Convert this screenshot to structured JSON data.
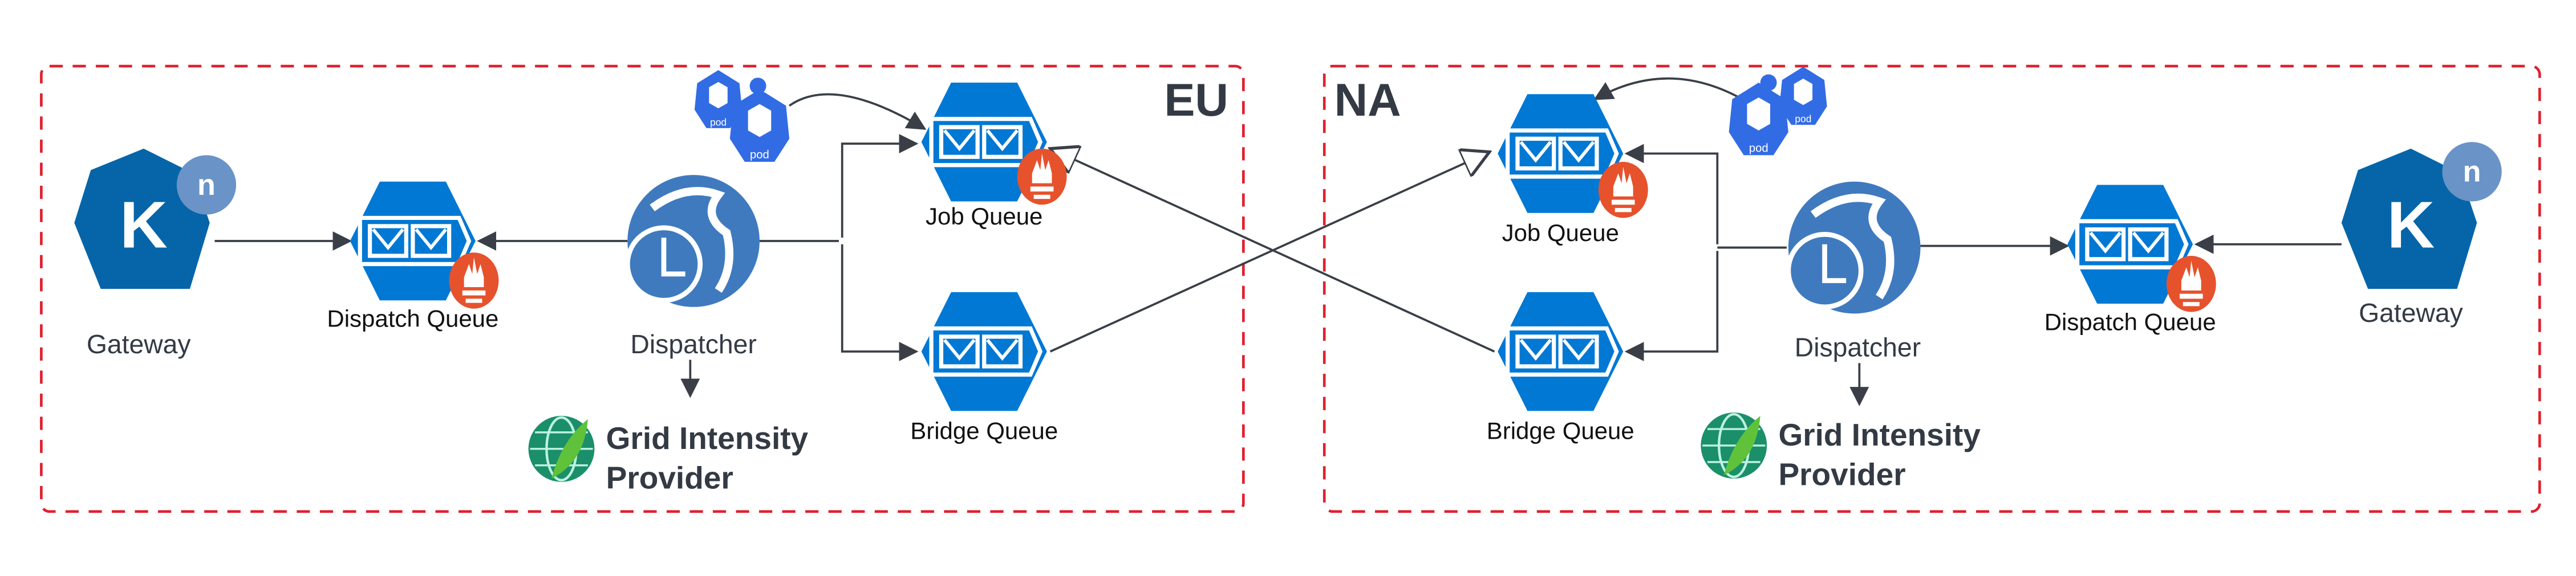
{
  "colors": {
    "region_border": "#e0202e",
    "queue": "#0078d4",
    "knative": "#0565a8",
    "knative_badge": "#6a93c8",
    "prometheus": "#e6522c",
    "dispatcher": "#3f7abf",
    "pod": "#326ce5",
    "text": "#333a44"
  },
  "regions": [
    {
      "name": "EU",
      "gateway": {
        "label": "Gateway",
        "icon": "knative-icon",
        "badge": "n",
        "letter": "K"
      },
      "dispatch_queue": {
        "label": "Dispatch Queue"
      },
      "dispatcher": {
        "label": "Dispatcher"
      },
      "job_queue": {
        "label": "Job Queue"
      },
      "bridge_queue": {
        "label": "Bridge Queue"
      },
      "grid_provider": {
        "line1": "Grid Intensity",
        "line2": "Provider"
      },
      "pod_label": "pod"
    },
    {
      "name": "NA",
      "gateway": {
        "label": "Gateway",
        "icon": "knative-icon",
        "badge": "n",
        "letter": "K"
      },
      "dispatch_queue": {
        "label": "Dispatch Queue"
      },
      "dispatcher": {
        "label": "Dispatcher"
      },
      "job_queue": {
        "label": "Job Queue"
      },
      "bridge_queue": {
        "label": "Bridge Queue"
      },
      "grid_provider": {
        "line1": "Grid Intensity",
        "line2": "Provider"
      },
      "pod_label": "pod"
    }
  ]
}
